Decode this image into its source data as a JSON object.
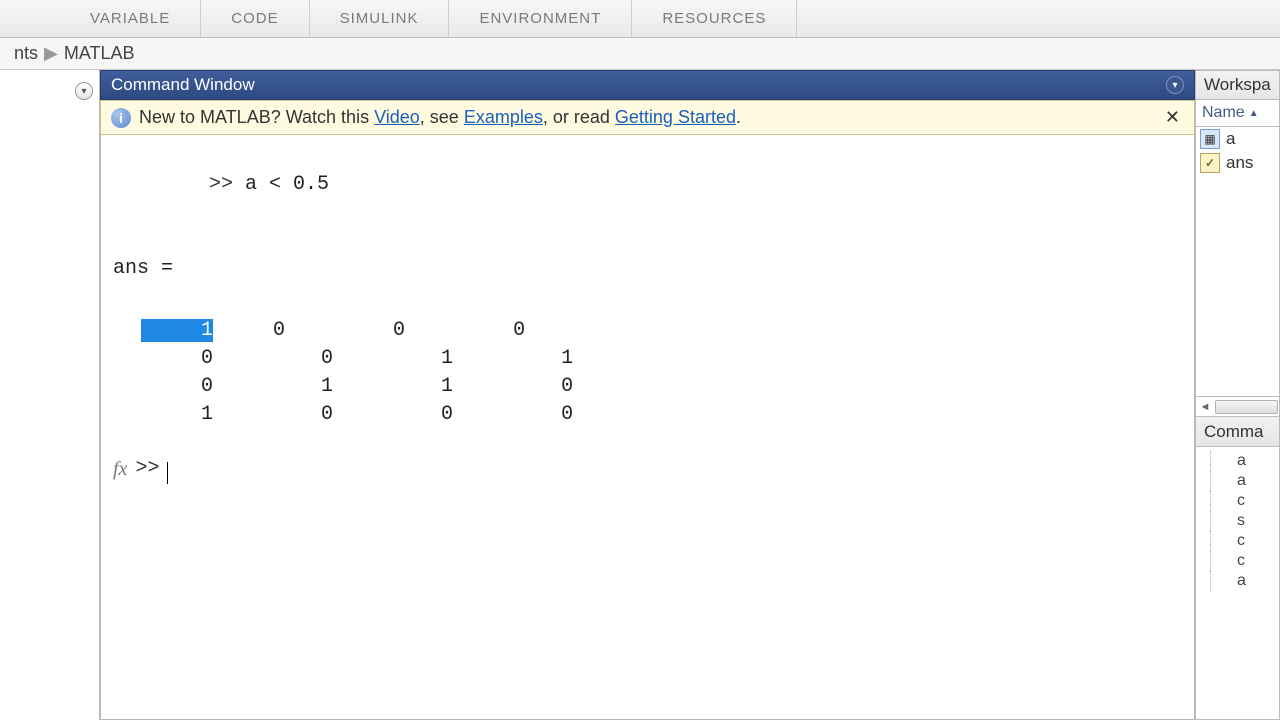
{
  "ribbon": {
    "groups": [
      "VARIABLE",
      "CODE",
      "SIMULINK",
      "ENVIRONMENT",
      "RESOURCES"
    ]
  },
  "breadcrumb": {
    "item0": "nts",
    "item1": "MATLAB"
  },
  "command_window": {
    "title": "Command Window",
    "info_prefix": "New to MATLAB? Watch this ",
    "link_video": "Video",
    "info_mid1": ", see ",
    "link_examples": "Examples",
    "info_mid2": ", or read ",
    "link_getting_started": "Getting Started",
    "info_suffix": ".",
    "prompt": ">>",
    "input_line": "a < 0.5",
    "ans_label": "ans =",
    "matrix": [
      [
        "1",
        "0",
        "0",
        "0"
      ],
      [
        "0",
        "0",
        "1",
        "1"
      ],
      [
        "0",
        "1",
        "1",
        "0"
      ],
      [
        "1",
        "0",
        "0",
        "0"
      ]
    ],
    "selection": {
      "row": 0,
      "col": 0
    },
    "fx_label": "fx"
  },
  "workspace": {
    "title": "Workspa",
    "col_name": "Name",
    "vars": [
      {
        "name": "a",
        "kind": "matrix"
      },
      {
        "name": "ans",
        "kind": "logical"
      }
    ]
  },
  "command_history": {
    "title": "Comma",
    "items": [
      "a",
      "a",
      "c",
      "s",
      "c",
      "c",
      "a"
    ]
  }
}
